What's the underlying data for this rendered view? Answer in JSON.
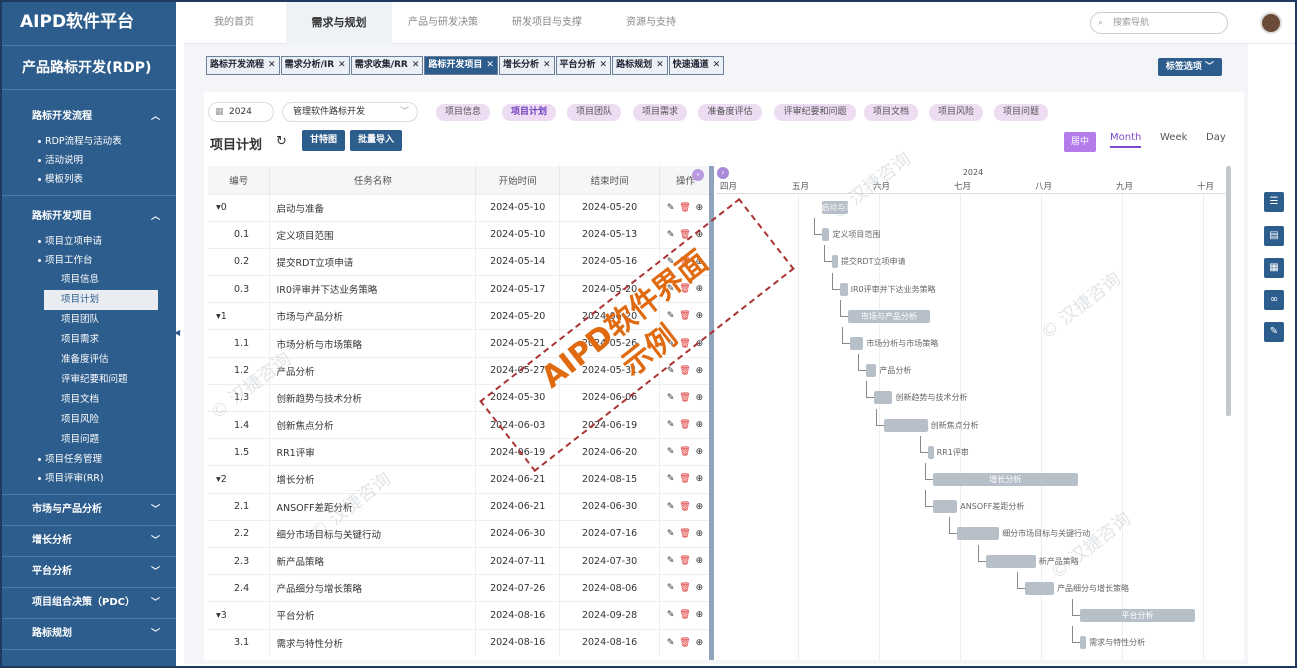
{
  "app_title": "AIPD软件平台",
  "module_title": "产品路标开发(RDP)",
  "sidebar": {
    "sections": [
      {
        "label": "路标开发流程",
        "items": [
          "RDP流程与活动表",
          "活动说明",
          "模板列表"
        ]
      },
      {
        "label": "路标开发项目",
        "items": [
          "项目立项申请",
          "项目工作台"
        ],
        "subitems": [
          "项目信息",
          "项目计划",
          "项目团队",
          "项目需求",
          "准备度评估",
          "评审纪要和问题",
          "项目文档",
          "项目风险",
          "项目问题"
        ],
        "items_after": [
          "项目任务管理",
          "项目评审(RR)"
        ]
      },
      {
        "label": "市场与产品分析"
      },
      {
        "label": "增长分析"
      },
      {
        "label": "平台分析"
      },
      {
        "label": "项目组合决策（PDC）"
      },
      {
        "label": "路标规划"
      }
    ]
  },
  "topnav": {
    "tabs": [
      "我的首页",
      "需求与规划",
      "产品与研发决策",
      "研发项目与支撑",
      "资源与支持"
    ],
    "search_placeholder": "搜索导航"
  },
  "chips": [
    "路标开发流程",
    "需求分析/IR",
    "需求收集/RR",
    "路标开发项目",
    "增长分析",
    "平台分析",
    "路标规划",
    "快速通道"
  ],
  "tag_options": "标签选项",
  "filters": {
    "year": "2024",
    "product": "管理软件路标开发"
  },
  "project_tabs": [
    "项目信息",
    "项目计划",
    "项目团队",
    "项目需求",
    "准备度评估",
    "评审纪要和问题",
    "项目文档",
    "项目风险",
    "项目问题"
  ],
  "plan": {
    "title": "项目计划",
    "gantt_btn": "甘特图",
    "import_btn": "批量导入",
    "center_btn": "居中",
    "views": [
      "Month",
      "Week",
      "Day"
    ]
  },
  "table": {
    "headers": [
      "编号",
      "任务名称",
      "开始时间",
      "结束时间",
      "操作"
    ],
    "rows": [
      {
        "no": "0",
        "name": "启动与准备",
        "start": "2024-05-10",
        "end": "2024-05-20",
        "parent": true
      },
      {
        "no": "0.1",
        "name": "定义项目范围",
        "start": "2024-05-10",
        "end": "2024-05-13"
      },
      {
        "no": "0.2",
        "name": "提交RDT立项申请",
        "start": "2024-05-14",
        "end": "2024-05-16"
      },
      {
        "no": "0.3",
        "name": "IR0评审并下达业务策略",
        "start": "2024-05-17",
        "end": "2024-05-20"
      },
      {
        "no": "1",
        "name": "市场与产品分析",
        "start": "2024-05-20",
        "end": "2024-06-20",
        "parent": true
      },
      {
        "no": "1.1",
        "name": "市场分析与市场策略",
        "start": "2024-05-21",
        "end": "2024-05-26"
      },
      {
        "no": "1.2",
        "name": "产品分析",
        "start": "2024-05-27",
        "end": "2024-05-31"
      },
      {
        "no": "1.3",
        "name": "创新趋势与技术分析",
        "start": "2024-05-30",
        "end": "2024-06-06"
      },
      {
        "no": "1.4",
        "name": "创新焦点分析",
        "start": "2024-06-03",
        "end": "2024-06-19"
      },
      {
        "no": "1.5",
        "name": "RR1评审",
        "start": "2024-06-19",
        "end": "2024-06-20"
      },
      {
        "no": "2",
        "name": "增长分析",
        "start": "2024-06-21",
        "end": "2024-08-15",
        "parent": true
      },
      {
        "no": "2.1",
        "name": "ANSOFF差距分析",
        "start": "2024-06-21",
        "end": "2024-06-30"
      },
      {
        "no": "2.2",
        "name": "细分市场目标与关键行动",
        "start": "2024-06-30",
        "end": "2024-07-16"
      },
      {
        "no": "2.3",
        "name": "新产品策略",
        "start": "2024-07-11",
        "end": "2024-07-30"
      },
      {
        "no": "2.4",
        "name": "产品细分与增长策略",
        "start": "2024-07-26",
        "end": "2024-08-06"
      },
      {
        "no": "3",
        "name": "平台分析",
        "start": "2024-08-16",
        "end": "2024-09-28",
        "parent": true
      },
      {
        "no": "3.1",
        "name": "需求与特性分析",
        "start": "2024-08-16",
        "end": "2024-08-16"
      }
    ]
  },
  "gantt": {
    "year": "2024",
    "months": [
      "四月",
      "五月",
      "六月",
      "七月",
      "八月",
      "九月",
      "十月"
    ]
  },
  "watermark": {
    "stamp_line1": "AIPD软件界面",
    "stamp_line2": "示例",
    "copy": "© 汉捷咨询"
  }
}
